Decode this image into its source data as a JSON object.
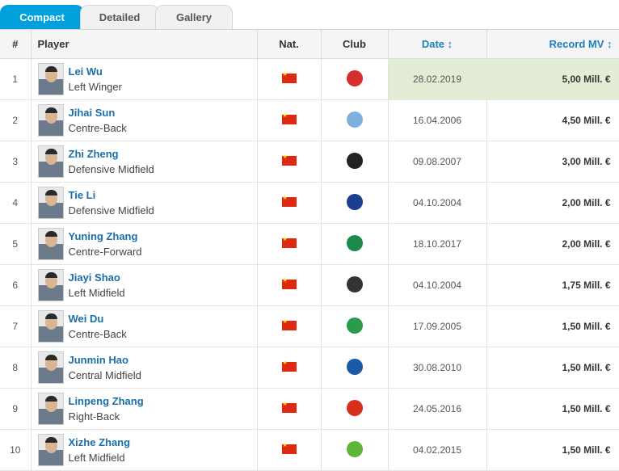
{
  "tabs": [
    "Compact",
    "Detailed",
    "Gallery"
  ],
  "columns": {
    "num": "#",
    "player": "Player",
    "nat": "Nat.",
    "club": "Club",
    "date": "Date ↕",
    "mv": "Record MV ↕"
  },
  "colors": {
    "accent": "#00a0dc",
    "link": "#1b6fa8",
    "highlight": "#e3edd6",
    "flag": "#de2910"
  },
  "rows": [
    {
      "num": "1",
      "name": "Lei Wu",
      "pos": "Left Winger",
      "nat": "China-flag-icon",
      "club": "espanyol-crest-icon",
      "date": "28.02.2019",
      "mv": "5,00 Mill. €"
    },
    {
      "num": "2",
      "name": "Jihai Sun",
      "pos": "Centre-Back",
      "nat": "China-flag-icon",
      "club": "man-city-crest-icon",
      "date": "16.04.2006",
      "mv": "4,50 Mill. €"
    },
    {
      "num": "3",
      "name": "Zhi Zheng",
      "pos": "Defensive Midfield",
      "nat": "China-flag-icon",
      "club": "charlton-crest-icon",
      "date": "09.08.2007",
      "mv": "3,00 Mill. €"
    },
    {
      "num": "4",
      "name": "Tie Li",
      "pos": "Defensive Midfield",
      "nat": "China-flag-icon",
      "club": "everton-crest-icon",
      "date": "04.10.2004",
      "mv": "2,00 Mill. €"
    },
    {
      "num": "5",
      "name": "Yuning Zhang",
      "pos": "Centre-Forward",
      "nat": "China-flag-icon",
      "club": "werder-crest-icon",
      "date": "18.10.2017",
      "mv": "2,00 Mill. €"
    },
    {
      "num": "6",
      "name": "Jiayi Shao",
      "pos": "Left Midfield",
      "nat": "China-flag-icon",
      "club": "1860-munich-crest-icon",
      "date": "04.10.2004",
      "mv": "1,75 Mill. €"
    },
    {
      "num": "7",
      "name": "Wei Du",
      "pos": "Centre-Back",
      "nat": "China-flag-icon",
      "club": "celtic-crest-icon",
      "date": "17.09.2005",
      "mv": "1,50 Mill. €"
    },
    {
      "num": "8",
      "name": "Junmin Hao",
      "pos": "Central Midfield",
      "nat": "China-flag-icon",
      "club": "schalke-crest-icon",
      "date": "30.08.2010",
      "mv": "1,50 Mill. €"
    },
    {
      "num": "9",
      "name": "Linpeng Zhang",
      "pos": "Right-Back",
      "nat": "China-flag-icon",
      "club": "guangzhou-crest-icon",
      "date": "24.05.2016",
      "mv": "1,50 Mill. €"
    },
    {
      "num": "10",
      "name": "Xizhe Zhang",
      "pos": "Left Midfield",
      "nat": "China-flag-icon",
      "club": "wolfsburg-crest-icon",
      "date": "04.02.2015",
      "mv": "1,50 Mill. €"
    }
  ]
}
